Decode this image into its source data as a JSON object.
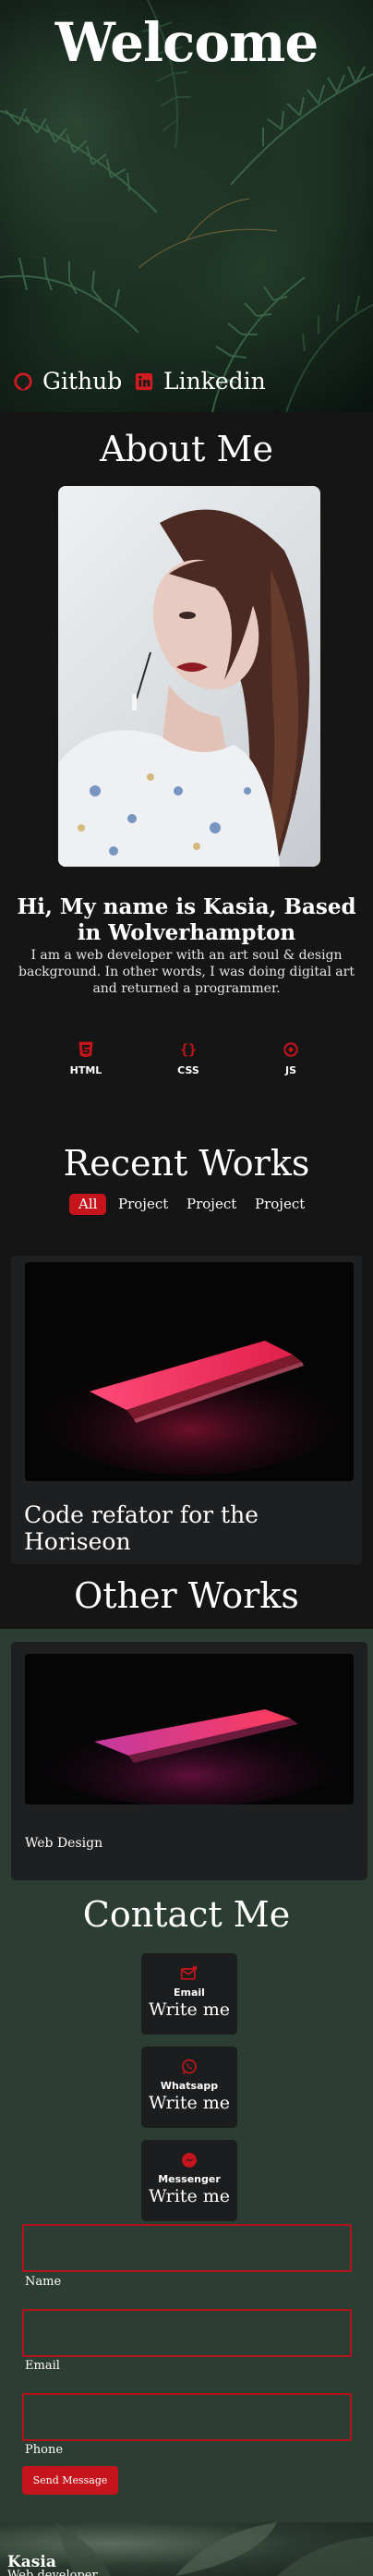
{
  "hero": {
    "title": "Welcome",
    "links": [
      {
        "label": "Github",
        "icon": "github-icon"
      },
      {
        "label": "Linkedin",
        "icon": "linkedin-icon"
      }
    ]
  },
  "about": {
    "title": "About Me",
    "heading": "Hi, My name is Kasia, Based in Wolverhampton",
    "text": "I am a web developer with an art soul & design background. In other words, I was doing digital art and returned a programmer.",
    "skills": [
      {
        "label": "HTML",
        "icon": "html5-icon"
      },
      {
        "label": "CSS",
        "icon": "css-braces-icon"
      },
      {
        "label": "JS",
        "icon": "js-icon"
      }
    ]
  },
  "recent": {
    "title": "Recent Works",
    "filters": [
      "All",
      "Project",
      "Project",
      "Project"
    ],
    "work_title": "Code refator for the Horiseon"
  },
  "other": {
    "title": "Other Works",
    "caption": "Web Design"
  },
  "contact": {
    "title": "Contact Me",
    "cards": [
      {
        "label": "Email",
        "action": "Write me",
        "icon": "email-icon"
      },
      {
        "label": "Whatsapp",
        "action": "Write me",
        "icon": "whatsapp-icon"
      },
      {
        "label": "Messenger",
        "action": "Write me",
        "icon": "messenger-icon"
      }
    ],
    "fields": {
      "name": "Name",
      "email": "Email",
      "phone": "Phone"
    },
    "send_label": "Send Message"
  },
  "footer": {
    "name": "Kasia",
    "role": "Web developer"
  },
  "colors": {
    "accent": "#c5141b",
    "background": "#151515",
    "green_section": "#2c3d33"
  }
}
